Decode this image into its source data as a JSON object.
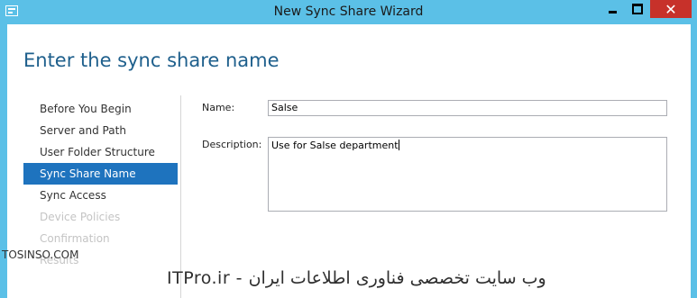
{
  "window": {
    "title": "New Sync Share Wizard",
    "close_glyph": "✕"
  },
  "page": {
    "heading": "Enter the sync share name"
  },
  "nav": {
    "items": [
      {
        "label": "Before You Begin",
        "state": "normal"
      },
      {
        "label": "Server and Path",
        "state": "normal"
      },
      {
        "label": "User Folder Structure",
        "state": "normal"
      },
      {
        "label": "Sync Share Name",
        "state": "active"
      },
      {
        "label": "Sync Access",
        "state": "normal"
      },
      {
        "label": "Device Policies",
        "state": "disabled"
      },
      {
        "label": "Confirmation",
        "state": "disabled"
      },
      {
        "label": "Results",
        "state": "disabled"
      }
    ]
  },
  "form": {
    "name_label": "Name:",
    "name_value": "Salse",
    "description_label": "Description:",
    "description_value": "Use for Salse department"
  },
  "watermark": {
    "left": "TOSINSO.COM",
    "center": "ITPro.ir - وب سایت تخصصی فناوری اطلاعات ایران"
  },
  "colors": {
    "titlebar": "#5bc0e7",
    "close_button": "#c7312a",
    "active_nav": "#1e73be",
    "heading": "#1e5f8c"
  }
}
